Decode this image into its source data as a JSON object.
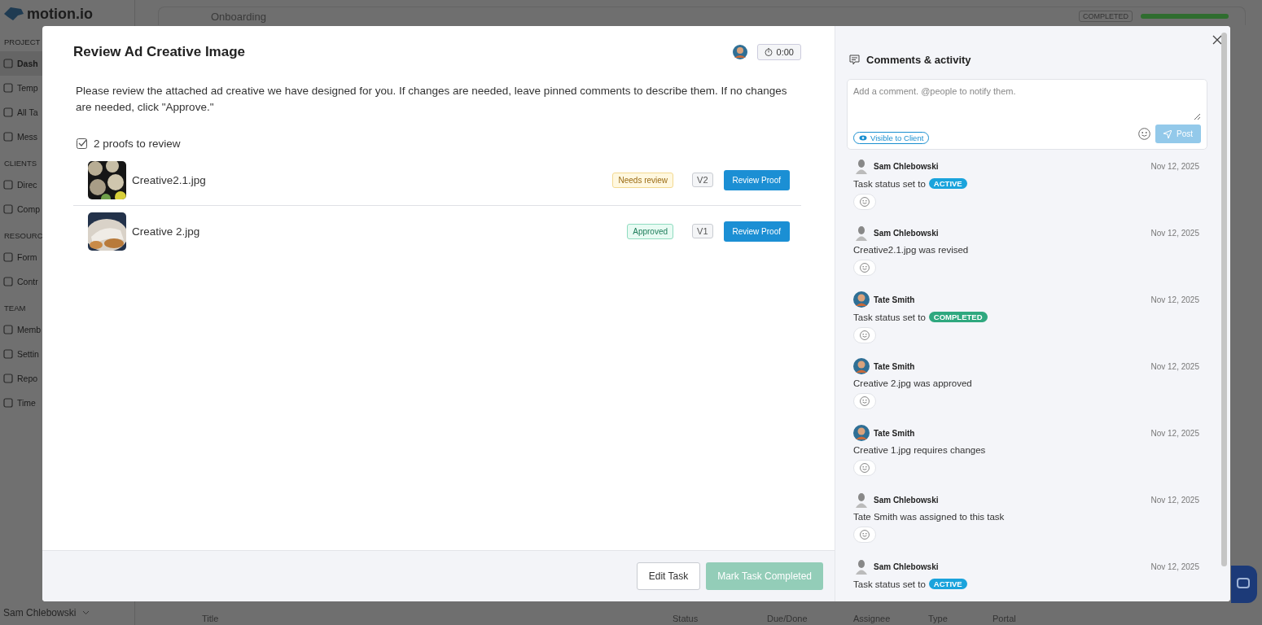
{
  "app": {
    "logo": "motion.io",
    "breadcrumb": "Onboarding",
    "status_badge": "COMPLETED",
    "progress": {
      "level": 1
    },
    "sidebar": [
      {
        "kind": "header",
        "label": "PROJECT"
      },
      {
        "kind": "item",
        "label": "Dash",
        "selected": true
      },
      {
        "kind": "item",
        "label": "Temp",
        "selected": false
      },
      {
        "kind": "item",
        "label": "All Ta",
        "selected": false
      },
      {
        "kind": "item",
        "label": "Mess",
        "selected": false
      },
      {
        "kind": "header",
        "label": "CLIENTS"
      },
      {
        "kind": "item",
        "label": "Direc",
        "selected": false
      },
      {
        "kind": "item",
        "label": "Comp",
        "selected": false
      },
      {
        "kind": "header",
        "label": "RESOURC"
      },
      {
        "kind": "item",
        "label": "Form",
        "selected": false
      },
      {
        "kind": "item",
        "label": "Contr",
        "selected": false
      },
      {
        "kind": "header",
        "label": "TEAM"
      },
      {
        "kind": "item",
        "label": "Memb",
        "selected": false
      },
      {
        "kind": "item",
        "label": "Settin",
        "selected": false
      },
      {
        "kind": "item",
        "label": "Repo",
        "selected": false
      },
      {
        "kind": "item",
        "label": "Time",
        "selected": false
      }
    ],
    "user": "Sam Chlebowski",
    "table_columns": [
      "Title",
      "Status",
      "Due/Done",
      "Assignee",
      "Type",
      "Portal"
    ]
  },
  "modal": {
    "title": "Review Ad Creative Image",
    "timer": "0:00",
    "description": "Please review the attached ad creative we have designed for you. If changes are needed, leave pinned comments to describe them. If no changes are needed, click \"Approve.\"",
    "proofs_summary": "2 proofs to review",
    "proofs": [
      {
        "kind": "picture",
        "name": "Creative2.1.jpg",
        "status": {
          "kind": "needs_review",
          "label": "Needs review"
        },
        "version": "V2",
        "button": "Review Proof"
      },
      {
        "kind": "picture",
        "name": "Creative 2.jpg",
        "status": {
          "kind": "approved",
          "label": "Approved"
        },
        "version": "V1",
        "button": "Review Proof"
      }
    ],
    "edit_button": "Edit Task",
    "complete_button": {
      "label": "Mark Task Completed",
      "disabled": true
    }
  },
  "comments": {
    "title": "Comments & activity",
    "placeholder": "Add a comment. @people to notify them.",
    "visibility": "Visible to Client",
    "post": {
      "label": "Post",
      "disabled": true
    },
    "activity": [
      {
        "author": {
          "kind": "gray",
          "name": "Sam Chlebowski"
        },
        "date": "Nov 12, 2025",
        "kind": "status",
        "text": "Task status set to",
        "tag": {
          "label": "ACTIVE",
          "color": "#1aa3dc"
        },
        "reaction": true
      },
      {
        "author": {
          "kind": "gray",
          "name": "Sam Chlebowski"
        },
        "date": "Nov 12, 2025",
        "kind": "text",
        "text": "Creative2.1.jpg was revised",
        "reaction": true
      },
      {
        "author": {
          "kind": "color",
          "name": "Tate Smith"
        },
        "date": "Nov 12, 2025",
        "kind": "status",
        "text": "Task status set to",
        "tag": {
          "label": "COMPLETED",
          "color": "#2fa87f"
        },
        "reaction": true
      },
      {
        "author": {
          "kind": "color",
          "name": "Tate Smith"
        },
        "date": "Nov 12, 2025",
        "kind": "text",
        "text": "Creative 2.jpg was approved",
        "reaction": true
      },
      {
        "author": {
          "kind": "color",
          "name": "Tate Smith"
        },
        "date": "Nov 12, 2025",
        "kind": "text",
        "text": "Creative 1.jpg requires changes",
        "reaction": true
      },
      {
        "author": {
          "kind": "gray",
          "name": "Sam Chlebowski"
        },
        "date": "Nov 12, 2025",
        "kind": "text",
        "text": "Tate Smith was assigned to this task",
        "reaction": true
      },
      {
        "author": {
          "kind": "gray",
          "name": "Sam Chlebowski"
        },
        "date": "Nov 12, 2025",
        "kind": "status",
        "text": "Task status set to",
        "tag": {
          "label": "ACTIVE",
          "color": "#1aa3dc"
        },
        "reaction": false
      }
    ]
  }
}
